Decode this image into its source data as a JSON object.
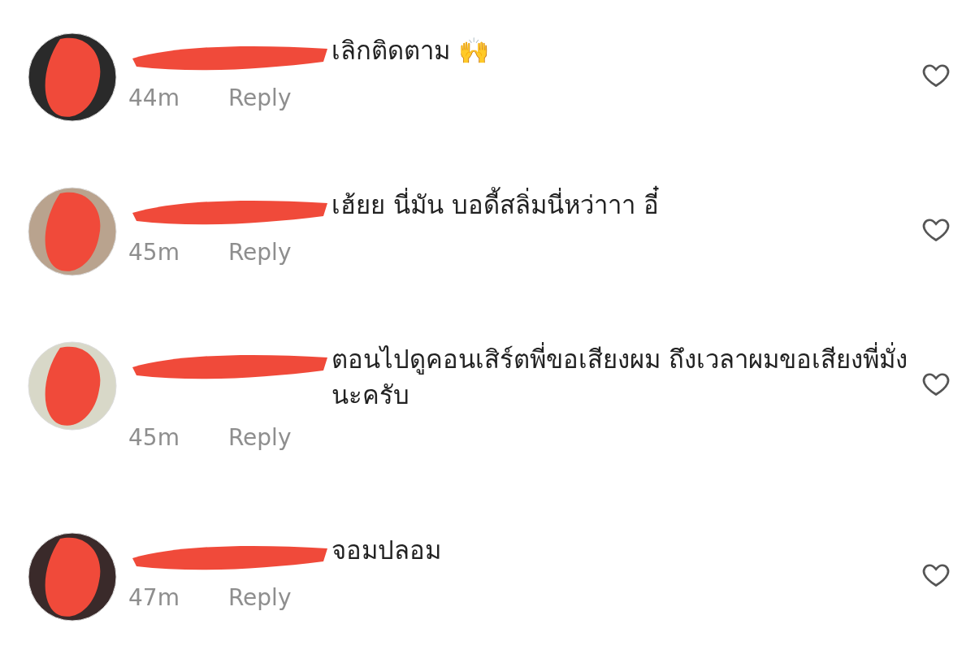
{
  "comments": [
    {
      "text": "เลิกติดตาม 🙌",
      "time": "44m",
      "reply": "Reply",
      "liked": false
    },
    {
      "text": "เฮ้ยย นี่มัน บอดี้สลิ่มนี่หว่าาา  อี๋",
      "time": "45m",
      "reply": "Reply",
      "liked": false
    },
    {
      "text": "ตอนไปดูคอนเสิร์ตพี่ขอเสียงผม ถึงเวลาผมขอเสียงพี่มั่งนะครับ",
      "time": "45m",
      "reply": "Reply",
      "liked": false
    },
    {
      "text": "จอมปลอม",
      "time": "47m",
      "reply": "Reply",
      "liked": false
    }
  ]
}
